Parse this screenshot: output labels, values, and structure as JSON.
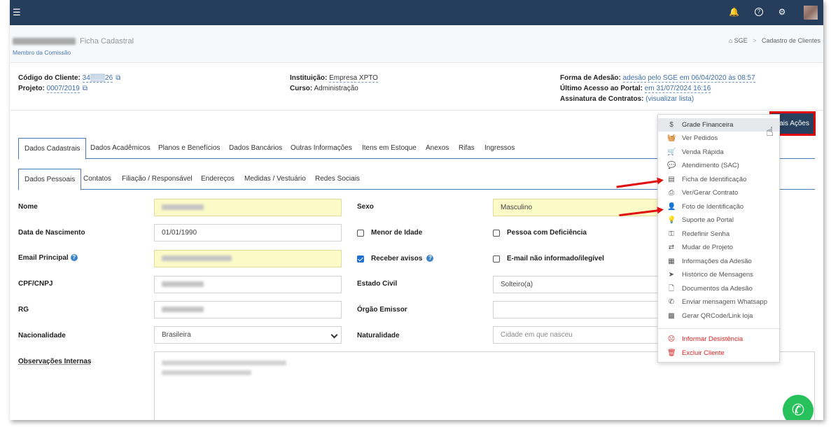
{
  "header": {
    "menu_icon": "hamburger-icon",
    "icons": [
      "bell-icon",
      "help-icon",
      "gear-icon"
    ],
    "bell_glyph": "🔔",
    "help_glyph": "?",
    "gear_glyph": "⚙"
  },
  "client": {
    "name_suffix": "Ficha Cadastral",
    "role": "Membro da Comissão"
  },
  "breadcrumb": {
    "home": "SGE",
    "sep": ">",
    "current": "Cadastro de Clientes"
  },
  "info": {
    "codigo_label": "Código do Cliente:",
    "codigo_value": "34▒▒▒26",
    "projeto_label": "Projeto:",
    "projeto_value": "0007/2019",
    "instituicao_label": "Instituição:",
    "instituicao_value": "Empresa XPTO",
    "curso_label": "Curso:",
    "curso_value": "Administração",
    "forma_label": "Forma de Adesão:",
    "forma_value": "adesão pelo SGE em 06/04/2020 às 08:57",
    "acesso_label": "Último Acesso ao Portal:",
    "acesso_value": "em 31/07/2024 16:16",
    "assinatura_label": "Assinatura de Contratos:",
    "assinatura_value": "(visualizar lista)"
  },
  "mais_acoes_label": "Mais Ações",
  "tabs_main": [
    "Dados Cadastrais",
    "Dados Acadêmicos",
    "Planos e Benefícios",
    "Dados Bancários",
    "Outras Informações",
    "Itens em Estoque",
    "Anexos",
    "Rifas",
    "Ingressos"
  ],
  "tabs_sub": [
    "Dados Pessoais",
    "Contatos",
    "Filiação / Responsável",
    "Endereços",
    "Medidas / Vestuário",
    "Redes Sociais"
  ],
  "form": {
    "nome_label": "Nome",
    "sexo_label": "Sexo",
    "sexo_value": "Masculino",
    "nascimento_label": "Data de Nascimento",
    "nascimento_value": "01/01/1990",
    "menor_label": "Menor de Idade",
    "deficiencia_label": "Pessoa com Deficiência",
    "email_label": "Email Principal",
    "receber_label": "Receber avisos",
    "email_nao_label": "E-mail não informado/ilegível",
    "cpf_label": "CPF/CNPJ",
    "estado_civil_label": "Estado Civil",
    "estado_civil_value": "Solteiro(a)",
    "rg_label": "RG",
    "orgao_label": "Órgão Emissor",
    "nacionalidade_label": "Nacionalidade",
    "nacionalidade_value": "Brasileira",
    "naturalidade_label": "Naturalidade",
    "naturalidade_placeholder": "Cidade em que nasceu",
    "observacoes_label": "Observações Internas"
  },
  "dropdown": [
    {
      "label": "Grade Financeira",
      "icon": "dollar-icon",
      "glyph": "$"
    },
    {
      "label": "Ver Pedidos",
      "icon": "basket-icon",
      "glyph": "🧺"
    },
    {
      "label": "Venda Rápida",
      "icon": "cart-icon",
      "glyph": "🛒"
    },
    {
      "label": "Atendimento (SAC)",
      "icon": "chat-icon",
      "glyph": "💬"
    },
    {
      "label": "Ficha de Identificação",
      "icon": "id-card-icon",
      "glyph": "▤"
    },
    {
      "label": "Ver/Gerar Contrato",
      "icon": "printer-icon",
      "glyph": "⎙"
    },
    {
      "label": "Foto de Identificação",
      "icon": "user-icon",
      "glyph": "👤"
    },
    {
      "label": "Suporte ao Portal",
      "icon": "lightbulb-icon",
      "glyph": "💡"
    },
    {
      "label": "Redefinir Senha",
      "icon": "key-icon",
      "glyph": "⚿"
    },
    {
      "label": "Mudar de Projeto",
      "icon": "swap-icon",
      "glyph": "⇄"
    },
    {
      "label": "Informações da Adesão",
      "icon": "calendar-icon",
      "glyph": "▦"
    },
    {
      "label": "Histórico de Mensagens",
      "icon": "paper-plane-icon",
      "glyph": "➤"
    },
    {
      "label": "Documentos da Adesão",
      "icon": "file-icon",
      "glyph": "🗋"
    },
    {
      "label": "Enviar mensagem Whatsapp",
      "icon": "whatsapp-icon",
      "glyph": "✆"
    },
    {
      "label": "Gerar QRCode/Link loja",
      "icon": "qrcode-icon",
      "glyph": "▩"
    },
    {
      "label": "Informar Desistência",
      "icon": "sad-face-icon",
      "glyph": "☹"
    },
    {
      "label": "Excluir Cliente",
      "icon": "trash-icon",
      "glyph": "🗑"
    }
  ],
  "colors": {
    "topbar": "#263e5c",
    "link": "#3d6da8",
    "highlight_input": "#fcfac7",
    "danger": "#d82323",
    "annotation": "#e01010",
    "whatsapp": "#27c15b"
  }
}
